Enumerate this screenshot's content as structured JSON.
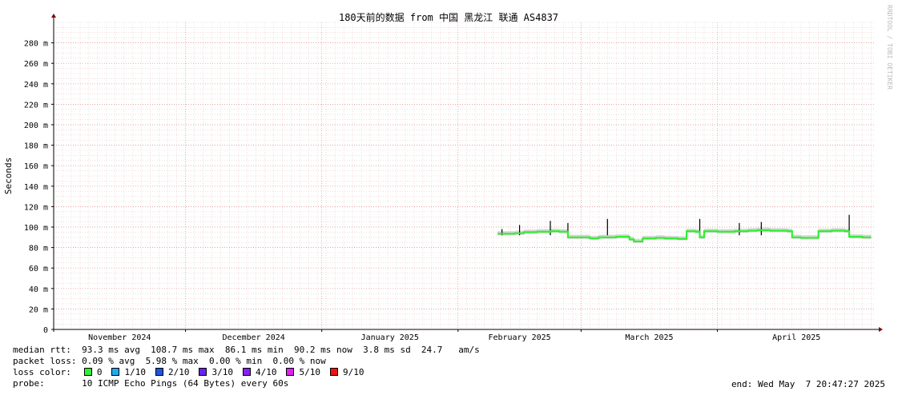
{
  "chart_data": {
    "type": "line",
    "title": "180天前的数据 from 中国 黑龙江 联通 AS4837",
    "ylabel": "Seconds",
    "xlabel": "",
    "ylim": [
      0,
      300
    ],
    "y_ticks": [
      {
        "v": 0,
        "label": "0"
      },
      {
        "v": 20,
        "label": "20 m"
      },
      {
        "v": 40,
        "label": "40 m"
      },
      {
        "v": 60,
        "label": "60 m"
      },
      {
        "v": 80,
        "label": "80 m"
      },
      {
        "v": 100,
        "label": "100 m"
      },
      {
        "v": 120,
        "label": "120 m"
      },
      {
        "v": 140,
        "label": "140 m"
      },
      {
        "v": 160,
        "label": "160 m"
      },
      {
        "v": 180,
        "label": "180 m"
      },
      {
        "v": 200,
        "label": "200 m"
      },
      {
        "v": 220,
        "label": "220 m"
      },
      {
        "v": 240,
        "label": "240 m"
      },
      {
        "v": 260,
        "label": "260 m"
      },
      {
        "v": 280,
        "label": "280 m"
      }
    ],
    "x_range": [
      "2024-11-01",
      "2025-05-07"
    ],
    "x_ticks": [
      {
        "date": "2024-11-01",
        "label": "November 2024"
      },
      {
        "date": "2024-12-01",
        "label": "December 2024"
      },
      {
        "date": "2025-01-01",
        "label": "January 2025"
      },
      {
        "date": "2025-02-01",
        "label": "February 2025"
      },
      {
        "date": "2025-03-01",
        "label": "March 2025"
      },
      {
        "date": "2025-04-01",
        "label": "April 2025"
      }
    ],
    "grid": true,
    "series": [
      {
        "color": "#33ee33",
        "points": [
          [
            "2025-02-10",
            93.5
          ],
          [
            "2025-02-14",
            94
          ],
          [
            "2025-02-16",
            95
          ],
          [
            "2025-02-19",
            95.5
          ],
          [
            "2025-02-22",
            96
          ],
          [
            "2025-02-24",
            95.5
          ],
          [
            "2025-02-26",
            90
          ],
          [
            "2025-03-01",
            90
          ],
          [
            "2025-03-03",
            89
          ],
          [
            "2025-03-05",
            90
          ],
          [
            "2025-03-09",
            90.5
          ],
          [
            "2025-03-12",
            88
          ],
          [
            "2025-03-13",
            86
          ],
          [
            "2025-03-15",
            89
          ],
          [
            "2025-03-18",
            89.5
          ],
          [
            "2025-03-20",
            89
          ],
          [
            "2025-03-23",
            88.5
          ],
          [
            "2025-03-25",
            96
          ],
          [
            "2025-03-27",
            95.5
          ],
          [
            "2025-03-28",
            90
          ],
          [
            "2025-03-29",
            96
          ],
          [
            "2025-04-01",
            95.5
          ],
          [
            "2025-04-03",
            95.5
          ],
          [
            "2025-04-05",
            96
          ],
          [
            "2025-04-08",
            96.5
          ],
          [
            "2025-04-10",
            97
          ],
          [
            "2025-04-13",
            96.5
          ],
          [
            "2025-04-17",
            96
          ],
          [
            "2025-04-18",
            90
          ],
          [
            "2025-04-20",
            89.5
          ],
          [
            "2025-04-23",
            89.5
          ],
          [
            "2025-04-24",
            96
          ],
          [
            "2025-04-27",
            96.5
          ],
          [
            "2025-04-30",
            96
          ],
          [
            "2025-05-01",
            90.5
          ],
          [
            "2025-05-04",
            90
          ],
          [
            "2025-05-06",
            90
          ]
        ]
      }
    ],
    "spikes": [
      [
        "2025-02-11",
        98
      ],
      [
        "2025-02-15",
        102
      ],
      [
        "2025-02-22",
        106
      ],
      [
        "2025-02-26",
        104
      ],
      [
        "2025-03-07",
        108
      ],
      [
        "2025-03-28",
        108
      ],
      [
        "2025-04-06",
        104
      ],
      [
        "2025-04-11",
        105
      ],
      [
        "2025-05-01",
        112
      ]
    ],
    "stats": {
      "median_rtt": "median rtt:  93.3 ms avg  108.7 ms max  86.1 ms min  90.2 ms now  3.8 ms sd  24.7   am/s",
      "packet_loss": "packet loss: 0.09 % avg  5.98 % max  0.00 % min  0.00 % now",
      "loss_color_label": "loss color:",
      "loss_colors": [
        {
          "label": "0",
          "color": "#33ee33"
        },
        {
          "label": "1/10",
          "color": "#22aaee"
        },
        {
          "label": "2/10",
          "color": "#2255dd"
        },
        {
          "label": "3/10",
          "color": "#6622ee"
        },
        {
          "label": "4/10",
          "color": "#8822ee"
        },
        {
          "label": "5/10",
          "color": "#dd22ee"
        },
        {
          "label": "9/10",
          "color": "#ee1111"
        }
      ],
      "probe": "probe:       10 ICMP Echo Pings (64 Bytes) every 60s",
      "end": "end: Wed May  7 20:47:27 2025"
    },
    "watermark": "RRDTOOL / TOBI OETIKER"
  }
}
